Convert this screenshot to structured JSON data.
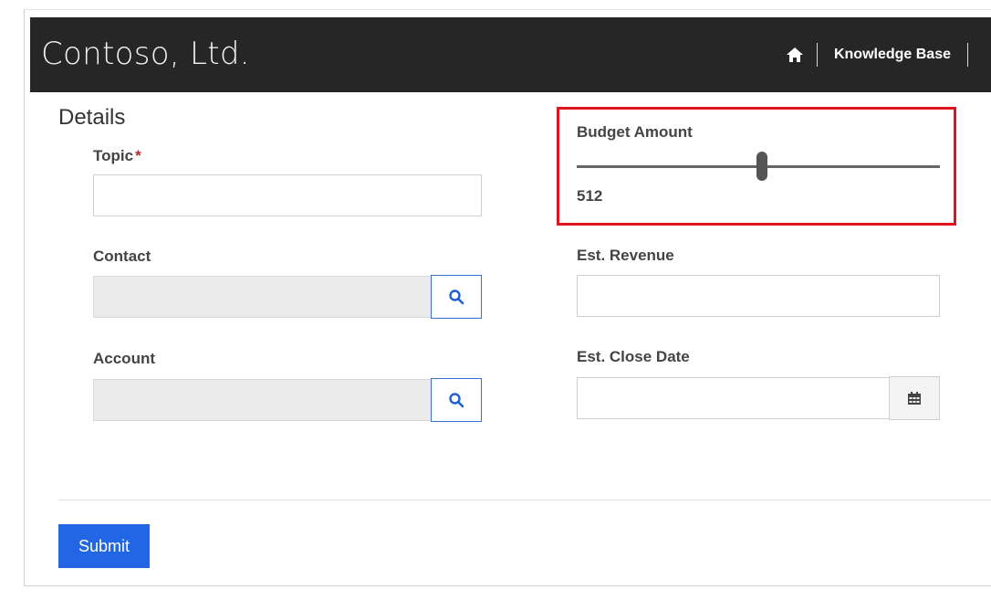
{
  "header": {
    "brand": "Contoso, Ltd.",
    "home_icon": "home-icon",
    "nav_link": "Knowledge Base"
  },
  "form": {
    "section_title": "Details",
    "topic": {
      "label": "Topic",
      "required_mark": "*",
      "value": ""
    },
    "contact": {
      "label": "Contact",
      "value": "",
      "lookup_icon": "search-icon"
    },
    "account": {
      "label": "Account",
      "value": "",
      "lookup_icon": "search-icon"
    },
    "budget": {
      "label": "Budget Amount",
      "value": "512",
      "slider_fraction": 0.51
    },
    "revenue": {
      "label": "Est. Revenue",
      "value": ""
    },
    "close_date": {
      "label": "Est. Close Date",
      "value": "",
      "picker_icon": "calendar-icon"
    },
    "submit_label": "Submit"
  },
  "colors": {
    "header_bg": "#262626",
    "accent": "#2266e3",
    "highlight": "#e0141e",
    "required": "#b22a2a"
  }
}
